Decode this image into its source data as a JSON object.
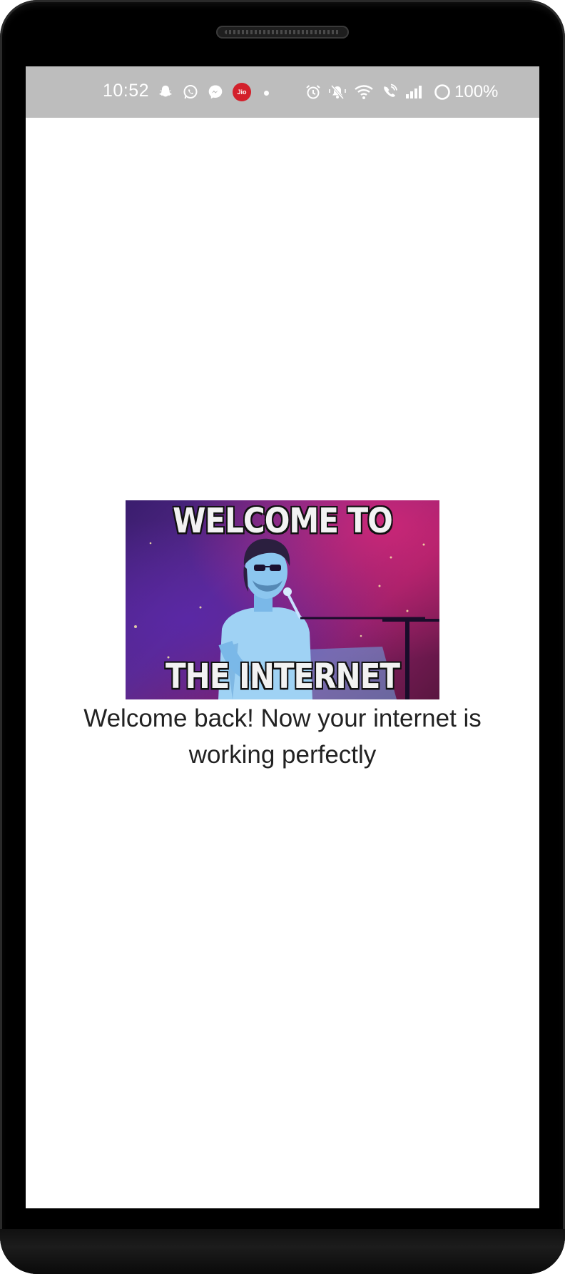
{
  "status_bar": {
    "time": "10:52",
    "battery": "100%",
    "carrier_badge": "Jio",
    "left_icons": [
      "snapchat-icon",
      "whatsapp-icon",
      "messenger-icon",
      "jio-icon"
    ],
    "right_icons": [
      "alarm-icon",
      "mute-icon",
      "wifi-icon",
      "wifi-calling-icon",
      "signal-icon",
      "battery-icon"
    ]
  },
  "main": {
    "gif_caption_top": "WELCOME TO",
    "gif_caption_bottom": "THE INTERNET",
    "message": "Welcome back! Now your internet is working perfectly"
  },
  "colors": {
    "status_bar_bg": "#bdbdbd",
    "screen_bg": "#ffffff",
    "text": "#222222",
    "jio_red": "#d3202b"
  }
}
